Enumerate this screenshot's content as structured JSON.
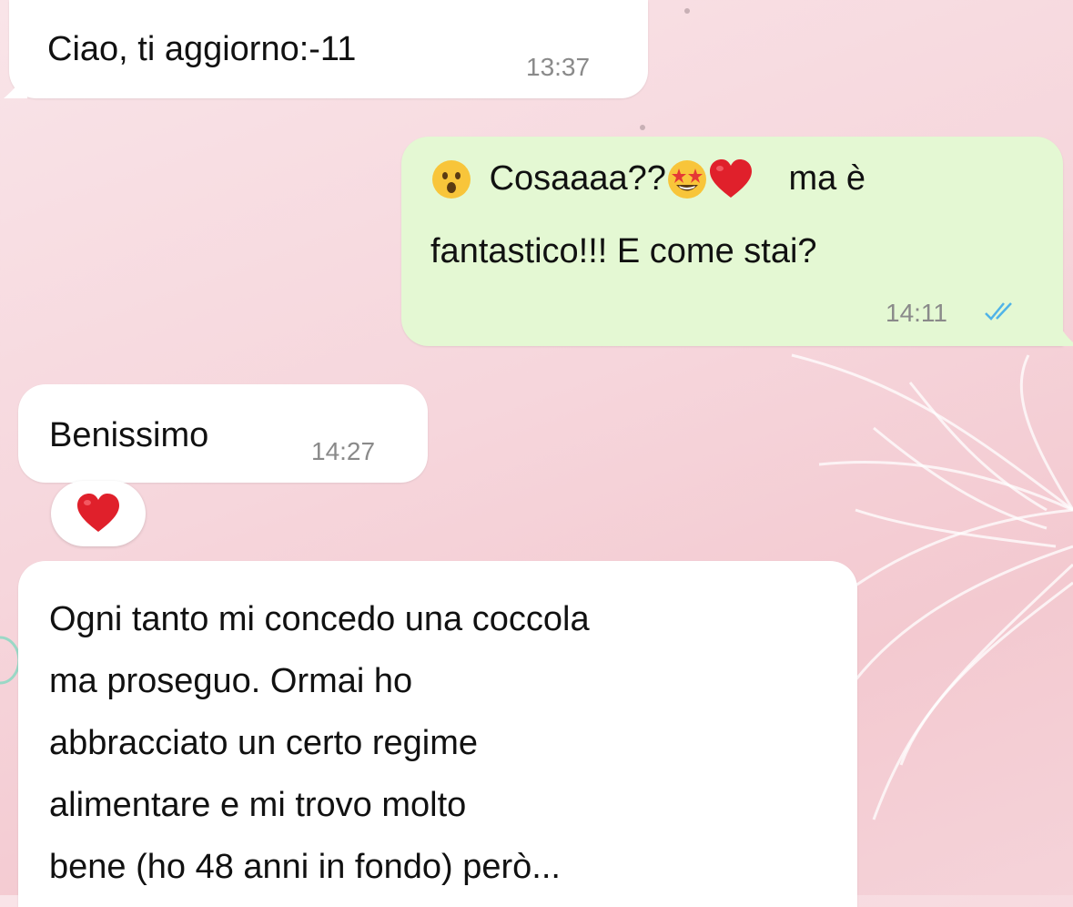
{
  "colors": {
    "incoming_bubble": "#ffffff",
    "outgoing_bubble": "#e4f8d3",
    "time_text": "#8a8a8a",
    "read_ticks": "#4fb3e8",
    "heart": "#e0202b"
  },
  "messages": [
    {
      "direction": "incoming",
      "text": "Ciao, ti aggiorno:-11",
      "time": "13:37"
    },
    {
      "direction": "outgoing",
      "icons": [
        "hushed-face-emoji",
        "star-struck-emoji",
        "red-heart-emoji"
      ],
      "text_part1": "Cosaaaa??",
      "text_part2": "ma è",
      "text_line2": "fantastico!!! E come stai?",
      "time": "14:11",
      "status": "read"
    },
    {
      "direction": "incoming",
      "text": "Benissimo",
      "time": "14:27",
      "reaction": "red-heart-emoji"
    },
    {
      "direction": "incoming",
      "lines": [
        "Ogni tanto mi concedo una coccola",
        "ma proseguo. Ormai ho",
        "abbracciato un certo regime",
        "alimentare e mi trovo molto",
        "bene (ho 48 anni in fondo) però..."
      ]
    }
  ]
}
